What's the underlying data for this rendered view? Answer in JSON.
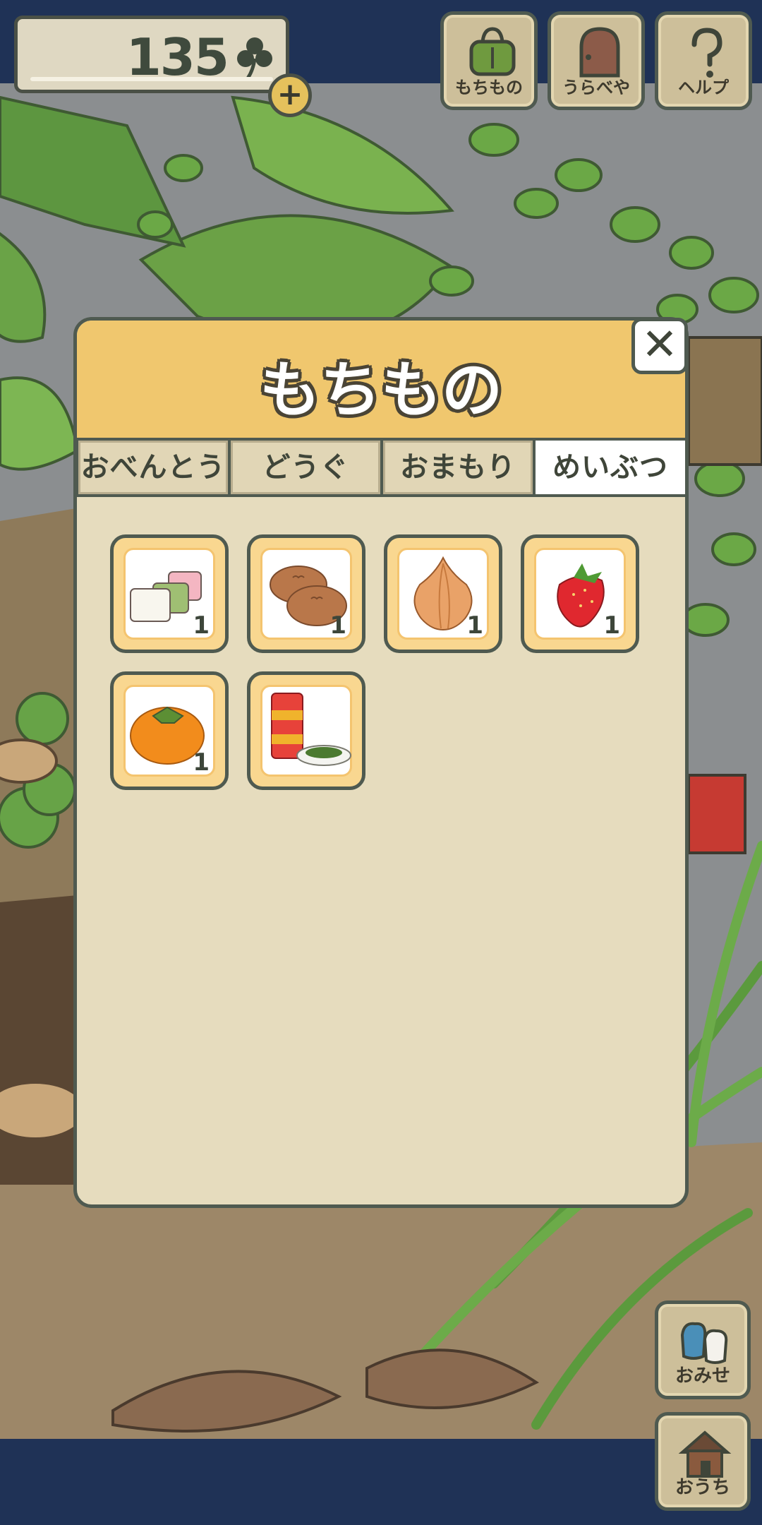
{
  "hud": {
    "clover_count": "135",
    "add_button_label": "+"
  },
  "top_buttons": [
    {
      "label": "もちもの",
      "icon": "bag-icon"
    },
    {
      "label": "うらべや",
      "icon": "door-icon"
    },
    {
      "label": "ヘルプ",
      "icon": "question-icon"
    }
  ],
  "modal": {
    "title": "もちもの",
    "close_label": "✕",
    "tabs": [
      {
        "label": "おべんとう",
        "active": false
      },
      {
        "label": "どうぐ",
        "active": false
      },
      {
        "label": "おまもり",
        "active": false
      },
      {
        "label": "めいぶつ",
        "active": true
      }
    ],
    "items": [
      {
        "name": "sweet-mochi-cubes",
        "qty": "1"
      },
      {
        "name": "manju-buns",
        "qty": "1"
      },
      {
        "name": "onion",
        "qty": "1"
      },
      {
        "name": "strawberry",
        "qty": "1"
      },
      {
        "name": "persimmon",
        "qty": "1"
      },
      {
        "name": "tea-tin-with-leaves",
        "qty": ""
      }
    ]
  },
  "side_buttons": [
    {
      "label": "おみせ",
      "icon": "shop-bags-icon"
    },
    {
      "label": "おうち",
      "icon": "house-icon"
    }
  ],
  "colors": {
    "frame": "#1f3256",
    "modal_header": "#f0c76e",
    "modal_body": "#e6dcbe",
    "border": "#4f5a50"
  }
}
